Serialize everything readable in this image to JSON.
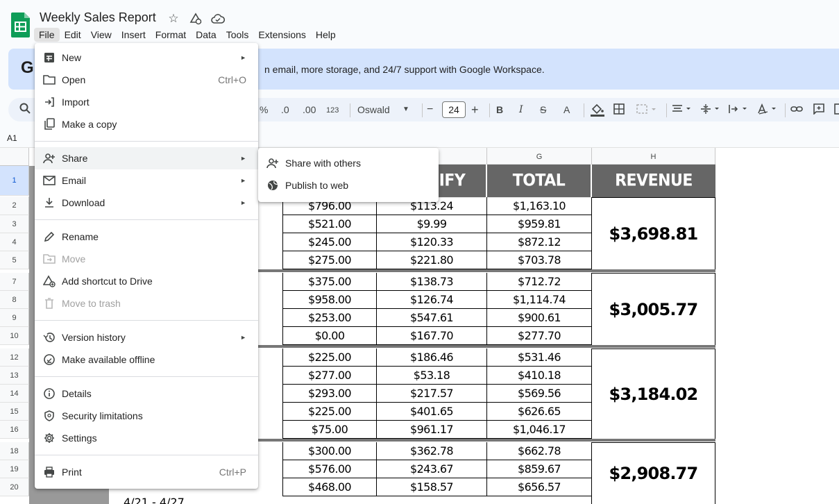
{
  "app": {
    "title": "Weekly Sales Report",
    "icons": [
      "star-icon",
      "move-to-drive-icon",
      "cloud-status-icon"
    ]
  },
  "menubar": [
    "File",
    "Edit",
    "View",
    "Insert",
    "Format",
    "Data",
    "Tools",
    "Extensions",
    "Help"
  ],
  "banner": {
    "logo": "G",
    "text": "n email, more storage, and 24/7 support with Google Workspace."
  },
  "toolbar": {
    "percent": "%",
    "dec_decrease": ".0",
    "dec_increase": ".00",
    "format_123": "123",
    "font": "Oswald",
    "font_size": "24",
    "minus": "−",
    "plus": "+",
    "bold": "B",
    "italic": "I",
    "strike": "S",
    "text_color": "A"
  },
  "namebox": "A1",
  "columns": {
    "g": "G",
    "h": "H"
  },
  "headers": {
    "f": "IFY",
    "g": "TOTAL",
    "h": "REVENUE"
  },
  "rows": [
    "1",
    "2",
    "3",
    "4",
    "5",
    "7",
    "8",
    "9",
    "10",
    "12",
    "13",
    "14",
    "15",
    "16",
    "18",
    "19",
    "20"
  ],
  "groups": [
    {
      "revenue": "$3,698.81",
      "rows": [
        [
          "$796.00",
          "$113.24",
          "$1,163.10"
        ],
        [
          "$521.00",
          "$9.99",
          "$959.81"
        ],
        [
          "$245.00",
          "$120.33",
          "$872.12"
        ],
        [
          "$275.00",
          "$221.80",
          "$703.78"
        ]
      ]
    },
    {
      "revenue": "$3,005.77",
      "rows": [
        [
          "$375.00",
          "$138.73",
          "$712.72"
        ],
        [
          "$958.00",
          "$126.74",
          "$1,114.74"
        ],
        [
          "$253.00",
          "$547.61",
          "$900.61"
        ],
        [
          "$0.00",
          "$167.70",
          "$277.70"
        ]
      ]
    },
    {
      "revenue": "$3,184.02",
      "rows": [
        [
          "$225.00",
          "$186.46",
          "$531.46"
        ],
        [
          "$277.00",
          "$53.18",
          "$410.18"
        ],
        [
          "$293.00",
          "$217.57",
          "$569.56"
        ],
        [
          "$225.00",
          "$401.65",
          "$626.65"
        ],
        [
          "$75.00",
          "$961.17",
          "$1,046.17"
        ]
      ]
    },
    {
      "revenue": "$2,908.77",
      "rows": [
        [
          "$300.00",
          "$362.78",
          "$662.78"
        ],
        [
          "$576.00",
          "$243.67",
          "$859.67"
        ],
        [
          "$468.00",
          "$158.57",
          "$656.57"
        ]
      ]
    }
  ],
  "file_menu": {
    "items": [
      {
        "label": "New",
        "icon": "new-sheet-icon",
        "arrow": "►"
      },
      {
        "label": "Open",
        "icon": "folder-icon",
        "shortcut": "Ctrl+O"
      },
      {
        "label": "Import",
        "icon": "import-icon"
      },
      {
        "label": "Make a copy",
        "icon": "copy-icon"
      },
      {
        "label": "Share",
        "icon": "person-add-icon",
        "arrow": "►"
      },
      {
        "label": "Email",
        "icon": "email-icon",
        "arrow": "►"
      },
      {
        "label": "Download",
        "icon": "download-icon",
        "arrow": "►"
      },
      {
        "label": "Rename",
        "icon": "pencil-icon"
      },
      {
        "label": "Move",
        "icon": "move-folder-icon"
      },
      {
        "label": "Add shortcut to Drive",
        "icon": "drive-shortcut-icon"
      },
      {
        "label": "Move to trash",
        "icon": "trash-icon"
      },
      {
        "label": "Version history",
        "icon": "history-icon",
        "arrow": "►"
      },
      {
        "label": "Make available offline",
        "icon": "offline-icon"
      },
      {
        "label": "Details",
        "icon": "info-icon"
      },
      {
        "label": "Security limitations",
        "icon": "shield-icon"
      },
      {
        "label": "Settings",
        "icon": "gear-icon"
      },
      {
        "label": "Print",
        "icon": "print-icon",
        "shortcut": "Ctrl+P"
      }
    ]
  },
  "share_submenu": {
    "items": [
      {
        "label": "Share with others",
        "icon": "person-add-icon"
      },
      {
        "label": "Publish to web",
        "icon": "globe-icon"
      }
    ]
  }
}
